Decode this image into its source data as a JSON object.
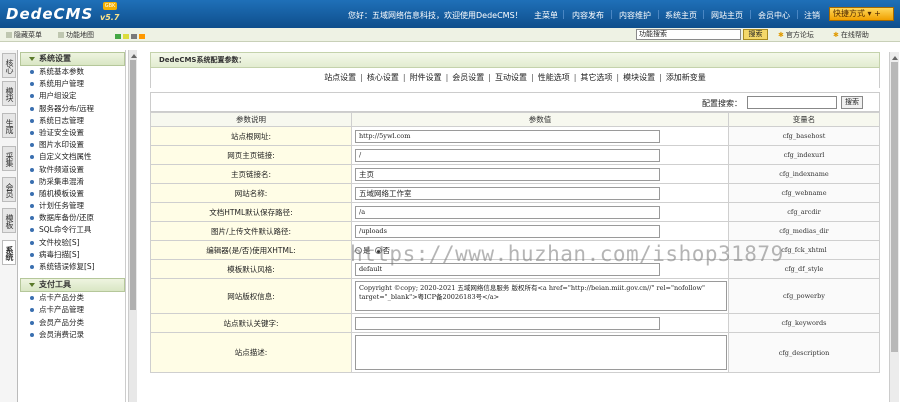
{
  "brand": {
    "logo": "DedeCMS",
    "version": "v5.7",
    "badge": "GBK"
  },
  "topbar": {
    "welcome": "您好：五域网络信息科技，欢迎使用DedeCMS！",
    "nav": [
      "主菜单",
      "内容发布",
      "内容维护",
      "系统主页",
      "网站主页",
      "会员中心",
      "注销"
    ],
    "quick": "快捷方式 ▾ +"
  },
  "toolbar": {
    "hide_menu": "隐藏菜单",
    "func_map": "功能地图",
    "swatches": [
      "#44a744",
      "#dcdc3c",
      "#7a7a7a",
      "#ff9900"
    ],
    "search_value": "功能搜索",
    "search_button": "搜索",
    "forum": "官方论坛",
    "help": "在线帮助"
  },
  "vtabs": [
    {
      "label": "核心",
      "active": false
    },
    {
      "label": "模块",
      "active": false
    },
    {
      "label": "生成",
      "active": false
    },
    {
      "label": "采集",
      "active": false
    },
    {
      "label": "会员",
      "active": false
    },
    {
      "label": "模板",
      "active": false
    },
    {
      "label": "系统",
      "active": true
    }
  ],
  "sidebar": {
    "group1": "系统设置",
    "items1": [
      "系统基本参数",
      "系统用户管理",
      "用户组设定",
      "服务器分布/远程",
      "系统日志管理",
      "验证安全设置",
      "图片水印设置",
      "自定义文档属性",
      "软件频道设置",
      "防采集串混淆",
      "随机模板设置",
      "计划任务管理",
      "数据库备份/还原",
      "SQL命令行工具",
      "文件校验[S]",
      "病毒扫描[S]",
      "系统错误修复[S]"
    ],
    "group2": "支付工具",
    "items2": [
      "点卡产品分类",
      "点卡产品管理",
      "会员产品分类",
      "会员消费记录"
    ]
  },
  "main": {
    "header": "DedeCMS系统配置参数：",
    "tabs": [
      "站点设置",
      "核心设置",
      "附件设置",
      "会员设置",
      "互动设置",
      "性能选项",
      "其它选项",
      "模块设置",
      "添加新变量"
    ],
    "config_search_label": "配置搜索：",
    "config_search_button": "搜索",
    "columns": [
      "参数说明",
      "参数值",
      "变量名"
    ],
    "rows": [
      {
        "label": "站点根网址:",
        "value": "http://5ywl.com",
        "var": "cfg_basehost",
        "type": "input"
      },
      {
        "label": "网页主页链接:",
        "value": "/",
        "var": "cfg_indexurl",
        "type": "input"
      },
      {
        "label": "主页链接名:",
        "value": "主页",
        "var": "cfg_indexname",
        "type": "input-cn"
      },
      {
        "label": "网站名称:",
        "value": "五域网络工作室",
        "var": "cfg_webname",
        "type": "input-cn"
      },
      {
        "label": "文档HTML默认保存路径:",
        "value": "/a",
        "var": "cfg_arcdir",
        "type": "input"
      },
      {
        "label": "图片/上传文件默认路径:",
        "value": "/uploads",
        "var": "cfg_medias_dir",
        "type": "input"
      },
      {
        "label": "编辑器(是/否)使用XHTML:",
        "value": "",
        "var": "cfg_fck_xhtml",
        "type": "radio",
        "options": [
          "是",
          "否"
        ],
        "selected": 1
      },
      {
        "label": "模板默认风格:",
        "value": "default",
        "var": "cfg_df_style",
        "type": "input"
      },
      {
        "label": "网站版权信息:",
        "value": "Copyright ©copy; 2020-2021 五域网络信息服务 版权所有<a href=\"http://beian.miit.gov.cn//\" rel=\"nofollow\" target=\"_blank\">粤ICP备20026183号</a>",
        "var": "cfg_powerby",
        "type": "textarea"
      },
      {
        "label": "站点默认关键字:",
        "value": "",
        "var": "cfg_keywords",
        "type": "input"
      },
      {
        "label": "站点描述:",
        "value": "",
        "var": "cfg_description",
        "type": "textarea"
      }
    ]
  },
  "watermark": "https://www.huzhan.com/ishop31879"
}
